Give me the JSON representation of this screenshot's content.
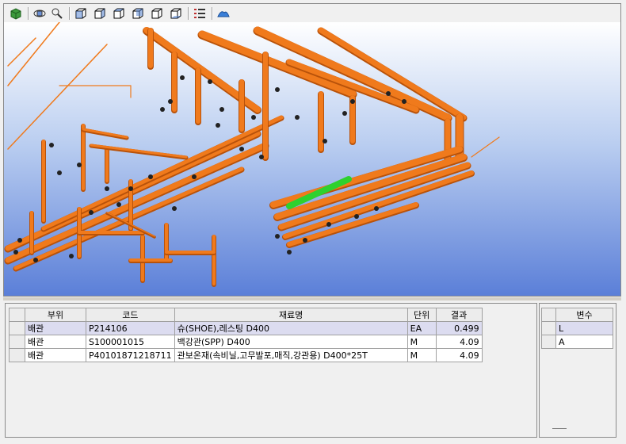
{
  "toolbar": {
    "buttons": [
      {
        "icon": "view-green-cube-icon"
      },
      {
        "icon": "rotate-view-icon"
      },
      {
        "icon": "fit-view-icon"
      },
      {
        "icon": "cube-view-front-icon"
      },
      {
        "icon": "cube-view-back-icon"
      },
      {
        "icon": "cube-view-left-icon"
      },
      {
        "icon": "cube-view-right-icon"
      },
      {
        "icon": "cube-view-top-icon"
      },
      {
        "icon": "cube-view-bottom-icon"
      },
      {
        "icon": "list-icon"
      },
      {
        "icon": "surface-icon"
      }
    ]
  },
  "materials_grid": {
    "headers": [
      "부위",
      "코드",
      "재료명",
      "단위",
      "결과"
    ],
    "rows": [
      {
        "part": "배관",
        "code": "P214106",
        "name": "슈(SHOE),레스팅  D400",
        "unit": "EA",
        "result": "0.499",
        "selected": true
      },
      {
        "part": "배관",
        "code": "S100001015",
        "name": "백강관(SPP)  D400",
        "unit": "M",
        "result": "4.09",
        "selected": false
      },
      {
        "part": "배관",
        "code": "P40101871218711",
        "name": "관보온재(속비닐,고무발포,매직,강관용)  D400*25T",
        "unit": "M",
        "result": "4.09",
        "selected": false
      }
    ]
  },
  "variables_grid": {
    "header": "변수",
    "rows": [
      {
        "name": "L",
        "selected": true
      },
      {
        "name": "A",
        "selected": false
      }
    ]
  },
  "colors": {
    "pipe": "#f07a1c",
    "pipe_dark": "#b8520a",
    "highlight": "#2ed12e",
    "sky_top": "#ffffff",
    "sky_bottom": "#5b7fd8"
  }
}
